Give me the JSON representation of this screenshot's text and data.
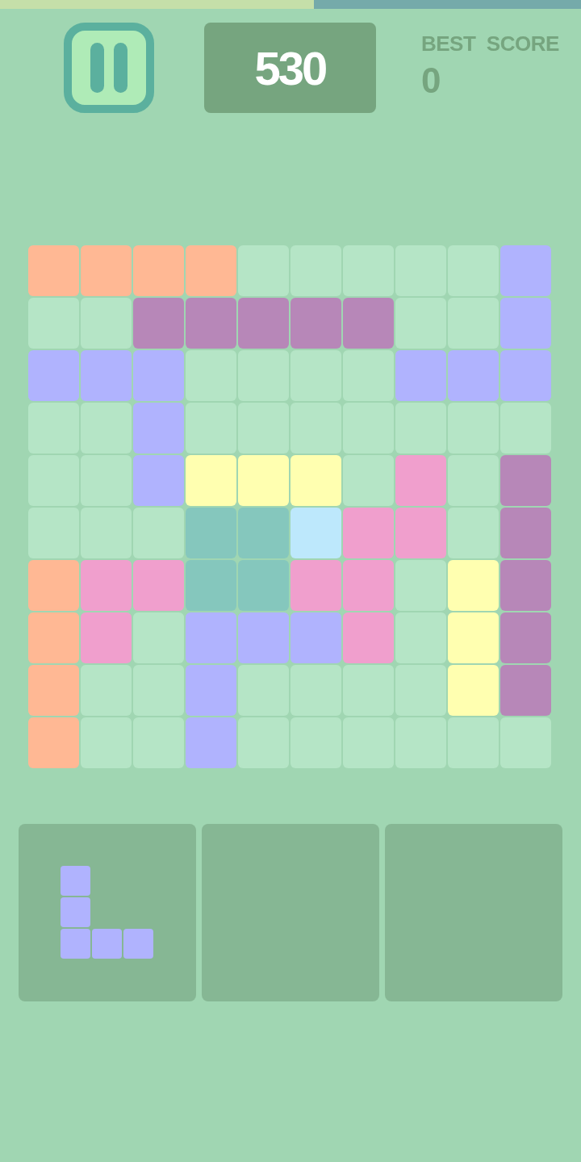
{
  "progress": {
    "level": 0.54
  },
  "pause_button": {
    "kind": "pause"
  },
  "score": "530",
  "best_score": {
    "label": "BEST  SCORE",
    "value": "0"
  },
  "board": {
    "rows": [
      {
        "cells": [
          {
            "color": "#ffb894"
          },
          {
            "color": "#ffb894"
          },
          {
            "color": "#ffb894"
          },
          {
            "color": "#ffb894"
          },
          {
            "color": "#b5e5c6"
          },
          {
            "color": "#b5e5c6"
          },
          {
            "color": "#b5e5c6"
          },
          {
            "color": "#b5e5c6"
          },
          {
            "color": "#b5e5c6"
          },
          {
            "color": "#b0b3fe"
          }
        ]
      },
      {
        "cells": [
          {
            "color": "#b5e5c6"
          },
          {
            "color": "#b5e5c6"
          },
          {
            "color": "#b787b8"
          },
          {
            "color": "#b787b8"
          },
          {
            "color": "#b787b8"
          },
          {
            "color": "#b787b8"
          },
          {
            "color": "#b787b8"
          },
          {
            "color": "#b5e5c6"
          },
          {
            "color": "#b5e5c6"
          },
          {
            "color": "#b0b3fe"
          }
        ]
      },
      {
        "cells": [
          {
            "color": "#b0b3fe"
          },
          {
            "color": "#b0b3fe"
          },
          {
            "color": "#b0b3fe"
          },
          {
            "color": "#b5e5c6"
          },
          {
            "color": "#b5e5c6"
          },
          {
            "color": "#b5e5c6"
          },
          {
            "color": "#b5e5c6"
          },
          {
            "color": "#b0b3fe"
          },
          {
            "color": "#b0b3fe"
          },
          {
            "color": "#b0b3fe"
          }
        ]
      },
      {
        "cells": [
          {
            "color": "#b5e5c6"
          },
          {
            "color": "#b5e5c6"
          },
          {
            "color": "#b0b3fe"
          },
          {
            "color": "#b5e5c6"
          },
          {
            "color": "#b5e5c6"
          },
          {
            "color": "#b5e5c6"
          },
          {
            "color": "#b5e5c6"
          },
          {
            "color": "#b5e5c6"
          },
          {
            "color": "#b5e5c6"
          },
          {
            "color": "#b5e5c6"
          }
        ]
      },
      {
        "cells": [
          {
            "color": "#b5e5c6"
          },
          {
            "color": "#b5e5c6"
          },
          {
            "color": "#b0b3fe"
          },
          {
            "color": "#ffffb0"
          },
          {
            "color": "#ffffb0"
          },
          {
            "color": "#ffffb0"
          },
          {
            "color": "#b5e5c6"
          },
          {
            "color": "#f09fcd"
          },
          {
            "color": "#b5e5c6"
          },
          {
            "color": "#b787b8"
          }
        ]
      },
      {
        "cells": [
          {
            "color": "#b5e5c6"
          },
          {
            "color": "#b5e5c6"
          },
          {
            "color": "#b5e5c6"
          },
          {
            "color": "#85c7bd"
          },
          {
            "color": "#85c7bd"
          },
          {
            "color": "#bde8fc"
          },
          {
            "color": "#f09fcd"
          },
          {
            "color": "#f09fcd"
          },
          {
            "color": "#b5e5c6"
          },
          {
            "color": "#b787b8"
          }
        ]
      },
      {
        "cells": [
          {
            "color": "#ffb894"
          },
          {
            "color": "#f09fcd"
          },
          {
            "color": "#f09fcd"
          },
          {
            "color": "#85c7bd"
          },
          {
            "color": "#85c7bd"
          },
          {
            "color": "#f09fcd"
          },
          {
            "color": "#f09fcd"
          },
          {
            "color": "#b5e5c6"
          },
          {
            "color": "#ffffb0"
          },
          {
            "color": "#b787b8"
          }
        ]
      },
      {
        "cells": [
          {
            "color": "#ffb894"
          },
          {
            "color": "#f09fcd"
          },
          {
            "color": "#b5e5c6"
          },
          {
            "color": "#b0b3fe"
          },
          {
            "color": "#b0b3fe"
          },
          {
            "color": "#b0b3fe"
          },
          {
            "color": "#f09fcd"
          },
          {
            "color": "#b5e5c6"
          },
          {
            "color": "#ffffb0"
          },
          {
            "color": "#b787b8"
          }
        ]
      },
      {
        "cells": [
          {
            "color": "#ffb894"
          },
          {
            "color": "#b5e5c6"
          },
          {
            "color": "#b5e5c6"
          },
          {
            "color": "#b0b3fe"
          },
          {
            "color": "#b5e5c6"
          },
          {
            "color": "#b5e5c6"
          },
          {
            "color": "#b5e5c6"
          },
          {
            "color": "#b5e5c6"
          },
          {
            "color": "#ffffb0"
          },
          {
            "color": "#b787b8"
          }
        ]
      },
      {
        "cells": [
          {
            "color": "#ffb894"
          },
          {
            "color": "#b5e5c6"
          },
          {
            "color": "#b5e5c6"
          },
          {
            "color": "#b0b3fe"
          },
          {
            "color": "#b5e5c6"
          },
          {
            "color": "#b5e5c6"
          },
          {
            "color": "#b5e5c6"
          },
          {
            "color": "#b5e5c6"
          },
          {
            "color": "#b5e5c6"
          },
          {
            "color": "#b5e5c6"
          }
        ]
      }
    ]
  },
  "tray": [
    {
      "kind": "piece",
      "color": "#b0b3fe",
      "rows": [
        {
          "blocks": [
            {
              "filled": true
            },
            {
              "filled": false
            },
            {
              "filled": false
            }
          ]
        },
        {
          "blocks": [
            {
              "filled": true
            },
            {
              "filled": false
            },
            {
              "filled": false
            }
          ]
        },
        {
          "blocks": [
            {
              "filled": true
            },
            {
              "filled": true
            },
            {
              "filled": true
            }
          ]
        }
      ]
    },
    {
      "kind": "empty"
    },
    {
      "kind": "empty"
    }
  ]
}
